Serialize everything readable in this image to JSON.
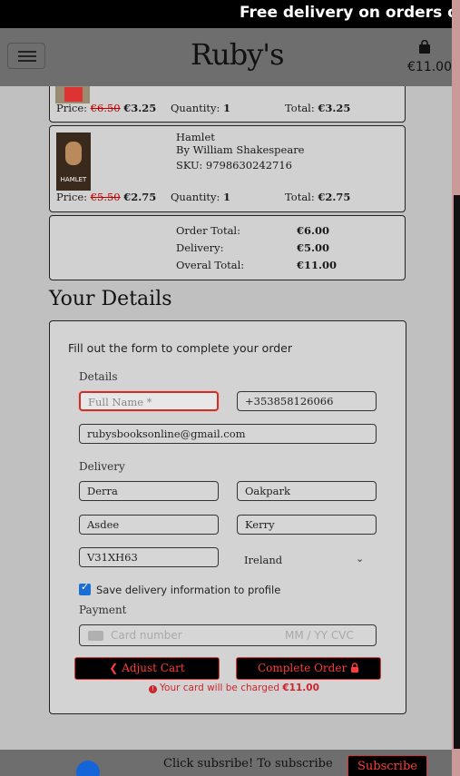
{
  "banner": {
    "text": "Free delivery on orders o"
  },
  "header": {
    "brand": "Ruby's",
    "cart_total": "€11.00"
  },
  "cart": {
    "items": [
      {
        "title": "",
        "author": "",
        "sku": "",
        "price_label": "Price:",
        "old_price": "€6.50",
        "price": "€3.25",
        "quantity_label": "Quantity:",
        "quantity": "1",
        "total_label": "Total:",
        "total": "€3.25"
      },
      {
        "title": "Hamlet",
        "author": "By William Shakespeare",
        "sku": "SKU: 9798630242716",
        "cover_text": "HAMLET",
        "price_label": "Price:",
        "old_price": "€5.50",
        "price": "€2.75",
        "quantity_label": "Quantity:",
        "quantity": "1",
        "total_label": "Total:",
        "total": "€2.75"
      }
    ],
    "summary": {
      "order_total_label": "Order Total:",
      "order_total": "€6.00",
      "delivery_label": "Delivery:",
      "delivery": "€5.00",
      "overall_label": "Overal Total:",
      "overall": "€11.00"
    }
  },
  "details": {
    "section_title": "Your Details",
    "intro": "Fill out the form to complete your order",
    "details_label": "Details",
    "full_name_placeholder": "Full Name *",
    "phone": "+353858126066",
    "email": "rubysbooksonline@gmail.com",
    "delivery_label": "Delivery",
    "address1": "Derra",
    "address2": "Oakpark",
    "town": "Asdee",
    "county": "Kerry",
    "postcode": "V31XH63",
    "country": "Ireland",
    "save_label": "Save delivery information to profile",
    "payment_label": "Payment",
    "card_placeholder": "Card number",
    "card_expiry_placeholder": "MM / YY  CVC",
    "adjust_cart": "Adjust Cart",
    "complete_order": "Complete Order",
    "charge_text": "Your card will be charged",
    "charge_amount": "€11.00"
  },
  "footer": {
    "subscribe_text": "Click subsribe! To subscribe",
    "subscribe_button": "Subscribe"
  },
  "colors": {
    "accent": "#d2232a",
    "checkbox": "#1a6fd6",
    "facebook": "#1565d8"
  }
}
